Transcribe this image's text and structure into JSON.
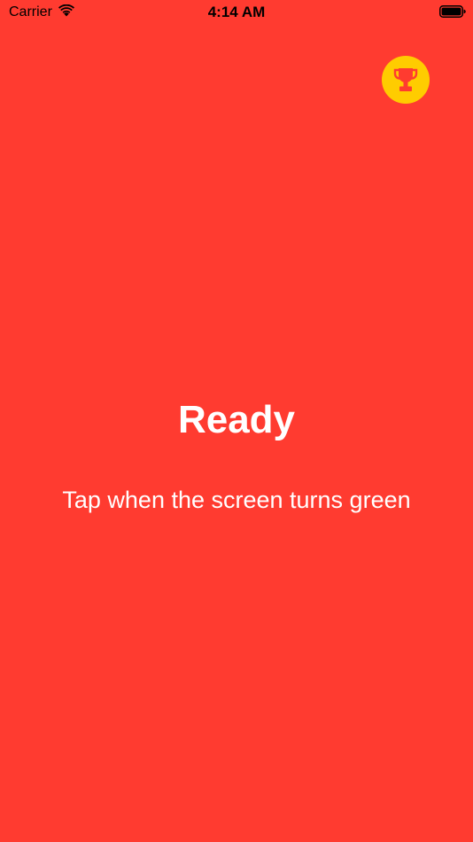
{
  "status_bar": {
    "carrier": "Carrier",
    "time": "4:14 AM",
    "wifi_icon": "wifi-icon",
    "battery_icon": "battery-icon"
  },
  "header": {
    "trophy_icon": "trophy-icon"
  },
  "main": {
    "title": "Ready",
    "subtitle": "Tap when the screen turns green"
  },
  "colors": {
    "background": "#FF3B30",
    "trophy_button": "#FFCC00",
    "trophy_icon": "#FF3B30",
    "text": "#FFFFFF"
  }
}
